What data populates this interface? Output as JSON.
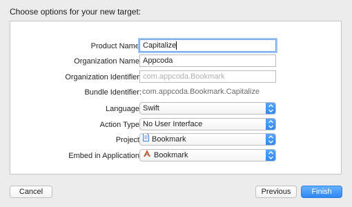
{
  "dialog": {
    "title": "Choose options for your new target:"
  },
  "form": {
    "product_name": {
      "label": "Product Name:",
      "value": "Capitalize"
    },
    "organization_name": {
      "label": "Organization Name:",
      "value": "Appcoda"
    },
    "organization_identifier": {
      "label": "Organization Identifier:",
      "placeholder": "com.appcoda.Bookmark"
    },
    "bundle_identifier": {
      "label": "Bundle Identifier:",
      "value": "com.appcoda.Bookmark.Capitalize"
    },
    "language": {
      "label": "Language:",
      "selected": "Swift"
    },
    "action_type": {
      "label": "Action Type:",
      "selected": "No User Interface"
    },
    "project": {
      "label": "Project:",
      "selected": "Bookmark",
      "icon": "project-file-icon"
    },
    "embed_in_application": {
      "label": "Embed in Application:",
      "selected": "Bookmark",
      "icon": "app-icon"
    }
  },
  "buttons": {
    "cancel": "Cancel",
    "previous": "Previous",
    "finish": "Finish"
  },
  "colors": {
    "accent": "#2f86f3",
    "focus_ring": "#9fc5f2"
  }
}
